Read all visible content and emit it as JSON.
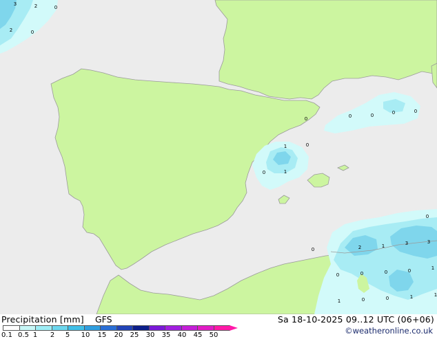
{
  "legend": {
    "title": "Precipitation [mm]",
    "model": "GFS",
    "datetime": "Sa 18-10-2025 09..12 UTC (06+06)",
    "credit": "©weatheronline.co.uk",
    "ticks": [
      "0.1",
      "0.5",
      "1",
      "2",
      "5",
      "10",
      "15",
      "20",
      "25",
      "30",
      "35",
      "40",
      "45",
      "50"
    ],
    "scale_colors": [
      "#ffffff",
      "#c8f7f7",
      "#9eeef6",
      "#6cd7ee",
      "#40c0e8",
      "#2f9fe0",
      "#2a6fd6",
      "#2244b8",
      "#0d1f8a",
      "#7a19d8",
      "#a21fe0",
      "#c51fd8",
      "#e21cc6",
      "#ff1aa8"
    ]
  },
  "map": {
    "land_color": "#ccf5a0",
    "sea_color": "#ececec",
    "precip_colors": {
      "light": "#d2fafa",
      "medium": "#a8ecf4",
      "strong": "#7fd6ec"
    },
    "values": [
      {
        "text": "3"
      },
      {
        "text": "2"
      },
      {
        "text": "0"
      },
      {
        "text": "2"
      },
      {
        "text": "0"
      },
      {
        "text": "1"
      },
      {
        "text": "0"
      },
      {
        "text": "0"
      },
      {
        "text": "1"
      },
      {
        "text": "0"
      },
      {
        "text": "0"
      },
      {
        "text": "0"
      },
      {
        "text": "0"
      },
      {
        "text": "0"
      },
      {
        "text": "0"
      },
      {
        "text": "0"
      },
      {
        "text": "2"
      },
      {
        "text": "1"
      },
      {
        "text": "3"
      },
      {
        "text": "3"
      },
      {
        "text": "0"
      },
      {
        "text": "0"
      },
      {
        "text": "0"
      },
      {
        "text": "0"
      },
      {
        "text": "1"
      },
      {
        "text": "1"
      },
      {
        "text": "0"
      },
      {
        "text": "0"
      },
      {
        "text": "1"
      },
      {
        "text": "1"
      }
    ]
  }
}
